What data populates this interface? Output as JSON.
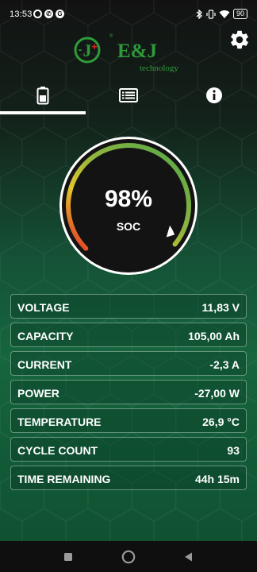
{
  "status_bar": {
    "time": "13:53",
    "battery_level": "90"
  },
  "header": {
    "brand_name": "E&J",
    "brand_sub": "technology"
  },
  "tabs": [
    {
      "name": "battery-tab",
      "icon": "battery-icon",
      "active": true
    },
    {
      "name": "list-tab",
      "icon": "list-icon",
      "active": false
    },
    {
      "name": "info-tab",
      "icon": "info-icon",
      "active": false
    }
  ],
  "gauge": {
    "value": "98%",
    "label": "SOC",
    "level": 0.98
  },
  "metrics": [
    {
      "label": "VOLTAGE",
      "value": "11,83 V"
    },
    {
      "label": "CAPACITY",
      "value": "105,00 Ah"
    },
    {
      "label": "CURRENT",
      "value": "-2,3 A"
    },
    {
      "label": "POWER",
      "value": "-27,00 W"
    },
    {
      "label": "TEMPERATURE",
      "value": "26,9 °C"
    },
    {
      "label": "CYCLE COUNT",
      "value": "93"
    },
    {
      "label": "TIME REMAINING",
      "value": "44h 15m"
    }
  ],
  "colors": {
    "brand_green": "#2e9b3a",
    "brand_red": "#e02020",
    "gauge_red": "#e22d25",
    "gauge_yellow": "#e3c62c",
    "gauge_green": "#4fa64a"
  }
}
